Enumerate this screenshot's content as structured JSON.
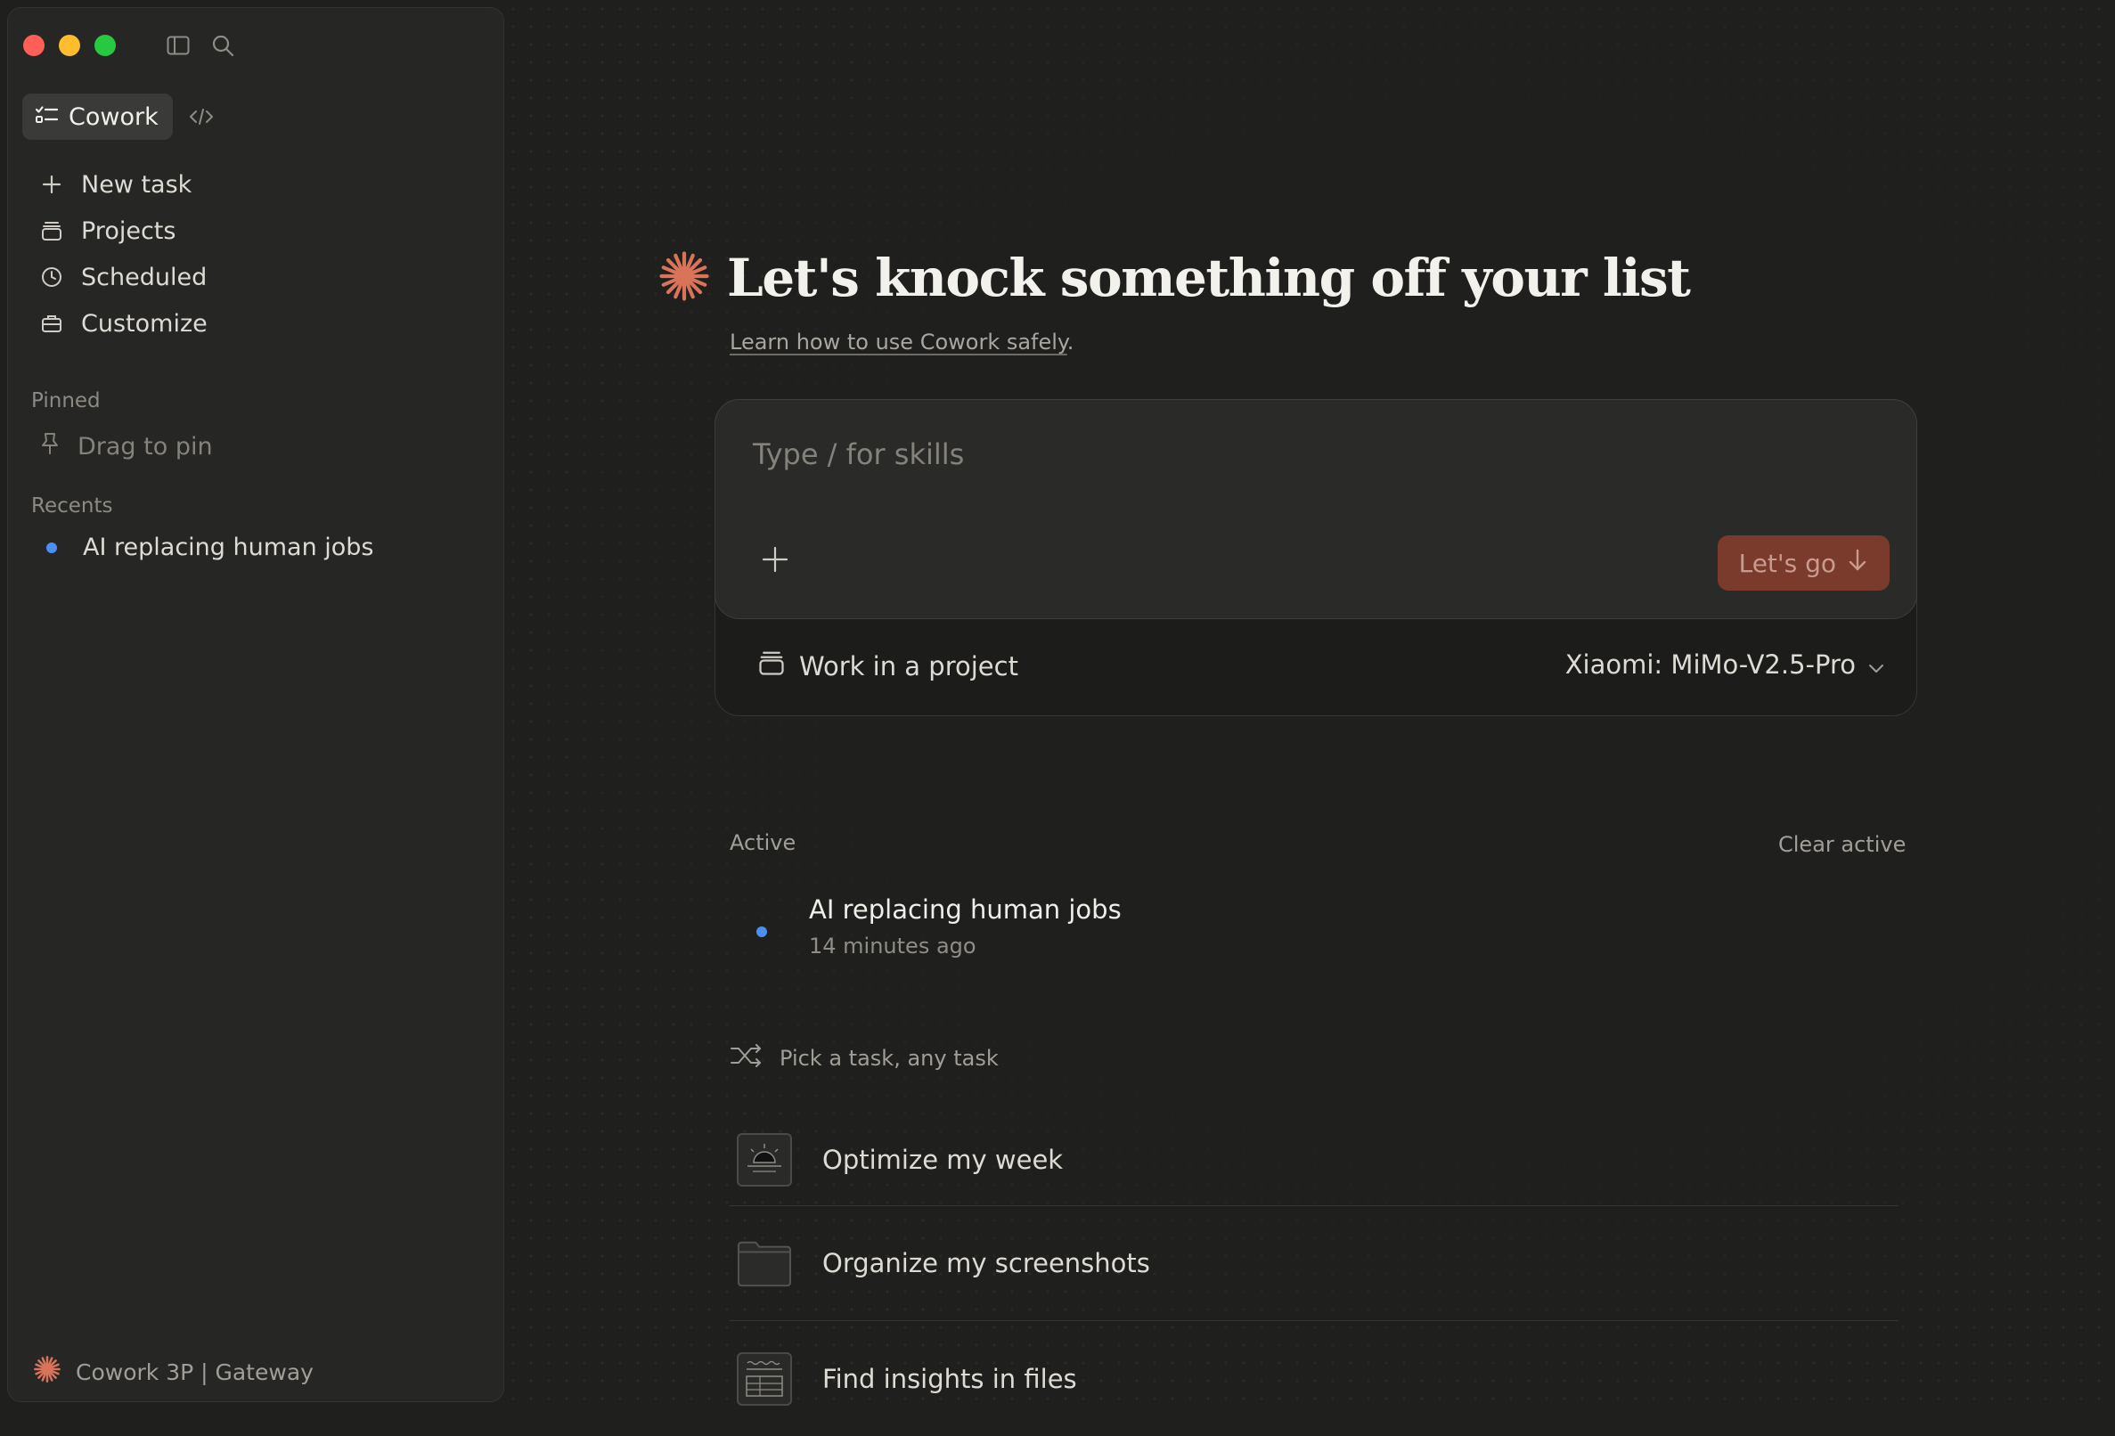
{
  "sidebar": {
    "mode_label": "Cowork",
    "nav": [
      {
        "label": "New task",
        "icon": "plus-icon"
      },
      {
        "label": "Projects",
        "icon": "projects-icon"
      },
      {
        "label": "Scheduled",
        "icon": "clock-icon"
      },
      {
        "label": "Customize",
        "icon": "toolbox-icon"
      }
    ],
    "pinned_label": "Pinned",
    "pin_hint": "Drag to pin",
    "recents_label": "Recents",
    "recents": [
      {
        "label": "AI replacing human jobs",
        "status_color": "#4a8ff5"
      }
    ],
    "footer": "Cowork 3P | Gateway"
  },
  "main": {
    "title": "Let's knock something off your list",
    "learn_link": "Learn how to use Cowork safely",
    "learn_suffix": ".",
    "composer": {
      "placeholder": "Type / for skills",
      "submit_label": "Let's go",
      "project_label": "Work in a project",
      "model_label": "Xiaomi: MiMo-V2.5-Pro"
    },
    "active": {
      "label": "Active",
      "clear_label": "Clear active",
      "items": [
        {
          "title": "AI replacing human jobs",
          "time": "14 minutes ago"
        }
      ]
    },
    "suggestions": {
      "label": "Pick a task, any task",
      "items": [
        {
          "label": "Optimize my week",
          "icon": "sunrise-calendar-icon"
        },
        {
          "label": "Organize my screenshots",
          "icon": "folder-icon"
        },
        {
          "label": "Find insights in files",
          "icon": "spreadsheet-icon"
        }
      ]
    }
  },
  "colors": {
    "accent": "#d9735a",
    "status_blue": "#4a8ff5",
    "submit_bg": "#7a3a2c",
    "background": "#1f1f1e",
    "sidebar_bg": "#262625"
  }
}
